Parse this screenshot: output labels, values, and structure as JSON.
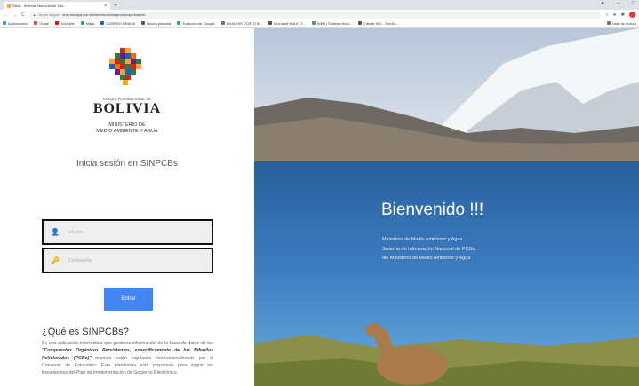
{
  "browser": {
    "tab_title": "SNIA - Sistema Nacional de Info...",
    "url_security": "No es seguro",
    "url": "snia.mmaya.gob.bo/web/modulos/pronacops/sinpcb/",
    "bookmarks": [
      {
        "label": "Aplicaciones",
        "color": "#4285f4"
      },
      {
        "label": "Gmail",
        "color": "#ea4335"
      },
      {
        "label": "YouTube",
        "color": "#ff0000"
      },
      {
        "label": "Maps",
        "color": "#34a853"
      },
      {
        "label": "CORREO MMAYA",
        "color": "#1565c0"
      },
      {
        "label": "Nueva pestaña",
        "color": "#555555"
      },
      {
        "label": "Traductor de Google",
        "color": "#4285f4"
      },
      {
        "label": "ANALISIS COSTO B...",
        "color": "#5c6bc0"
      },
      {
        "label": "Microsoft Word - T...",
        "color": "#555555"
      },
      {
        "label": "SNIA | Sistema Naci...",
        "color": "#43a047"
      },
      {
        "label": "Cliente SIG - GeoSo...",
        "color": "#555555"
      }
    ],
    "reading_list": "Lista de lectura"
  },
  "login": {
    "estado": "ESTADO PLURINACIONAL DE",
    "country": "BOLIVIA",
    "ministry_line1": "MINISTERIO DE",
    "ministry_line2": "MEDIO AMBIENTE Y AGUA",
    "title": "Inicia sesión en SINPCBs",
    "username_placeholder": "Usuario",
    "password_placeholder": "Contraseña",
    "submit_label": "Entrar",
    "about_heading": "¿Qué es SINPCBs?",
    "about_p1": "Es una aplicación informática que gestiona información de la base de datos de los ",
    "about_bold": "\"Compuestos Orgánicos Persistentes, específicamente de los Bifenilos Policlorados (PCBs)\"",
    "about_p2": " mismos están regulados internacionalmente por el Convenio de Estocolmo. Esta plataforma está preparada para seguir los lineamientos del Plan de Implementación de Gobierno Electrónico."
  },
  "hero": {
    "welcome": "Bienvenido !!!",
    "line1": "Ministerio de Medio Ambiente y Agua",
    "line2": "Sistema de Información Nacional de PCBs",
    "line3": "del Ministerio de Medio Ambiente y Agua"
  },
  "colors": {
    "button": "#4285f4",
    "field_border": "#111111"
  }
}
